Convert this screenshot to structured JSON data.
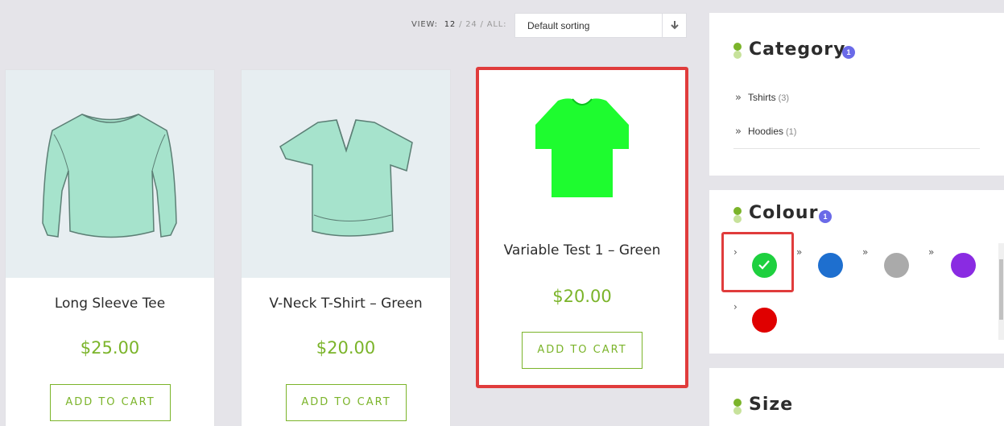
{
  "toolbar": {
    "view_label": "VIEW:",
    "view_12": "12",
    "view_24": "24",
    "view_all": "ALL:",
    "sep": "/",
    "sort_value": "Default sorting"
  },
  "products": [
    {
      "title": "Long Sleeve Tee",
      "price": "$25.00",
      "button": "ADD TO CART"
    },
    {
      "title": "V-Neck T-Shirt – Green",
      "price": "$20.00",
      "button": "ADD TO CART"
    },
    {
      "title": "Variable Test 1 – Green",
      "price": "$20.00",
      "button": "ADD TO CART"
    }
  ],
  "sidebar": {
    "category": {
      "title": "Category",
      "badge": "1",
      "items": [
        {
          "label": "Tshirts",
          "count": "(3)"
        },
        {
          "label": "Hoodies",
          "count": "(1)"
        }
      ]
    },
    "colour": {
      "title": "Colour",
      "badge": "1",
      "swatches": [
        {
          "name": "green",
          "color": "#1ed03f",
          "selected": true
        },
        {
          "name": "blue",
          "color": "#1e6fcf",
          "selected": false
        },
        {
          "name": "grey",
          "color": "#aaaaaa",
          "selected": false
        },
        {
          "name": "purple",
          "color": "#8a2be2",
          "selected": false
        },
        {
          "name": "red",
          "color": "#e00000",
          "selected": false
        }
      ]
    },
    "size": {
      "title": "Size"
    }
  },
  "colors": {
    "accent": "#7bb42a",
    "highlight": "#e03c3c",
    "badge": "#6a6ae8"
  }
}
